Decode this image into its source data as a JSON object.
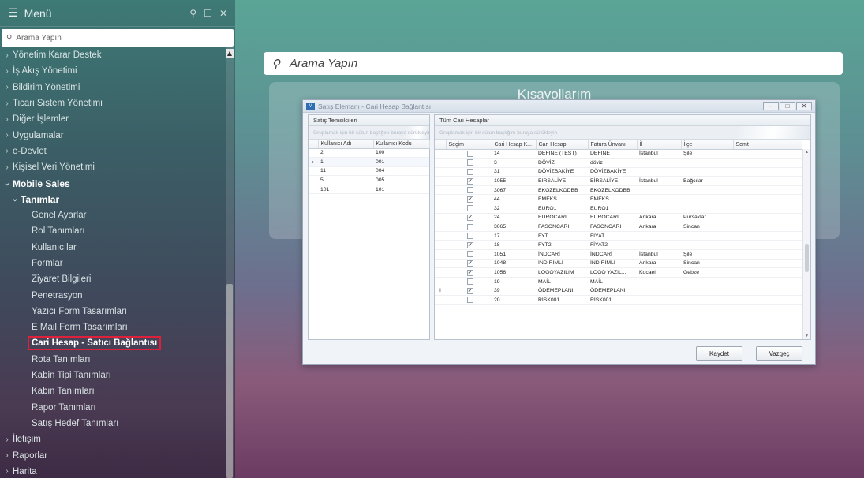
{
  "sidebar": {
    "title": "Menü",
    "search_placeholder": "Arama Yapın",
    "items": [
      {
        "label": "Yönetim Karar Destek",
        "level": 0,
        "chevron": "›"
      },
      {
        "label": "İş Akış Yönetimi",
        "level": 0,
        "chevron": "›"
      },
      {
        "label": "Bildirim Yönetimi",
        "level": 0,
        "chevron": "›"
      },
      {
        "label": "Ticari Sistem Yönetimi",
        "level": 0,
        "chevron": "›"
      },
      {
        "label": "Diğer İşlemler",
        "level": 0,
        "chevron": "›"
      },
      {
        "label": "Uygulamalar",
        "level": 0,
        "chevron": "›"
      },
      {
        "label": "e-Devlet",
        "level": 0,
        "chevron": "›"
      },
      {
        "label": "Kişisel Veri Yönetimi",
        "level": 0,
        "chevron": "›"
      },
      {
        "label": "Mobile Sales",
        "level": 0,
        "chevron": "⌄",
        "bold": true
      },
      {
        "label": "Tanımlar",
        "level": 1,
        "chevron": "⌄",
        "bold": true
      },
      {
        "label": "Genel Ayarlar",
        "level": 2
      },
      {
        "label": "Rol Tanımları",
        "level": 2
      },
      {
        "label": "Kullanıcılar",
        "level": 2
      },
      {
        "label": "Formlar",
        "level": 2
      },
      {
        "label": "Ziyaret Bilgileri",
        "level": 2
      },
      {
        "label": "Penetrasyon",
        "level": 2
      },
      {
        "label": "Yazıcı Form Tasarımları",
        "level": 2
      },
      {
        "label": "E Mail Form Tasarımları",
        "level": 2
      },
      {
        "label": "Cari Hesap - Satıcı Bağlantısı",
        "level": 2,
        "selected": true
      },
      {
        "label": "Rota Tanımları",
        "level": 2
      },
      {
        "label": "Kabin Tipi Tanımları",
        "level": 2
      },
      {
        "label": "Kabin Tanımları",
        "level": 2
      },
      {
        "label": "Rapor Tanımları",
        "level": 2
      },
      {
        "label": "Satış Hedef Tanımları",
        "level": 2
      },
      {
        "label": "İletişim",
        "level": 0,
        "chevron": "›"
      },
      {
        "label": "Raporlar",
        "level": 0,
        "chevron": "›"
      },
      {
        "label": "Harita",
        "level": 0,
        "chevron": "›"
      }
    ]
  },
  "main": {
    "search_placeholder": "Arama Yapın",
    "shortcuts_title": "Kısayollarım"
  },
  "dialog": {
    "title": "Satış Elemanı - Cari Hesap Bağlantısı",
    "app_icon_text": "M",
    "left_panel": {
      "caption": "Satış Temsilcileri",
      "group_hint": "Gruplamak için bir sütun başlığını buraya sürükleyin",
      "columns": [
        "Kullanıcı Adı",
        "Kullanıcı Kodu"
      ],
      "rows": [
        {
          "ind": "",
          "cells": [
            "2",
            "100"
          ]
        },
        {
          "ind": "▸",
          "cells": [
            "1",
            "001"
          ]
        },
        {
          "ind": "",
          "cells": [
            "11",
            "004"
          ]
        },
        {
          "ind": "",
          "cells": [
            "5",
            "005"
          ]
        },
        {
          "ind": "",
          "cells": [
            "101",
            "101"
          ]
        }
      ]
    },
    "right_panel": {
      "caption": "Tüm Cari Hesaplar",
      "group_hint": "Gruplamak için bir sütun başlığını buraya sürükleyin",
      "columns": [
        "Seçim",
        "Cari Hesap K...",
        "Cari Hesap",
        "Fatura Ünvanı",
        "İl",
        "İlçe",
        "Semt"
      ],
      "rows": [
        {
          "ind": "",
          "checked": false,
          "cells": [
            "14",
            "DEFINE (TEST)",
            "DEFINE",
            "İstanbul",
            "Şile",
            ""
          ]
        },
        {
          "ind": "",
          "checked": false,
          "cells": [
            "3",
            "DÖVİZ",
            "döviz",
            "",
            "",
            ""
          ]
        },
        {
          "ind": "",
          "checked": false,
          "cells": [
            "31",
            "DÖVİZBAKİYE",
            "DÖVİZBAKİYE",
            "",
            "",
            ""
          ]
        },
        {
          "ind": "",
          "checked": true,
          "cells": [
            "1055",
            "EIRSALİYE",
            "EİRSALİYE",
            "İstanbul",
            "Bağcılar",
            ""
          ]
        },
        {
          "ind": "",
          "checked": false,
          "cells": [
            "3067",
            "EKOZELKODBB",
            "EKOZELKODBB",
            "",
            "",
            ""
          ]
        },
        {
          "ind": "",
          "checked": true,
          "cells": [
            "44",
            "EMEKS",
            "EMEKS",
            "",
            "",
            ""
          ]
        },
        {
          "ind": "",
          "checked": false,
          "cells": [
            "32",
            "EURO1",
            "EURO1",
            "",
            "",
            ""
          ]
        },
        {
          "ind": "",
          "checked": true,
          "cells": [
            "24",
            "EUROCARI",
            "EUROCARI",
            "Ankara",
            "Pursaklar",
            ""
          ]
        },
        {
          "ind": "",
          "checked": false,
          "cells": [
            "3065",
            "FASONCARI",
            "FASONCARI",
            "Ankara",
            "Sincan",
            ""
          ]
        },
        {
          "ind": "",
          "checked": false,
          "cells": [
            "17",
            "FYT",
            "FİYAT",
            "",
            "",
            ""
          ]
        },
        {
          "ind": "",
          "checked": true,
          "cells": [
            "18",
            "FYT2",
            "FİYAT2",
            "",
            "",
            ""
          ]
        },
        {
          "ind": "",
          "checked": false,
          "cells": [
            "1051",
            "İNDCARİ",
            "İNDCARİ",
            "İstanbul",
            "Şile",
            ""
          ]
        },
        {
          "ind": "",
          "checked": true,
          "cells": [
            "1048",
            "İNDİRİMLİ",
            "İNDİRİMLİ",
            "Ankara",
            "Sincan",
            ""
          ]
        },
        {
          "ind": "",
          "checked": true,
          "cells": [
            "1056",
            "LOGOYAZILIM",
            "LOGO YAZIL...",
            "Kocaeli",
            "Gebze",
            ""
          ]
        },
        {
          "ind": "",
          "checked": false,
          "cells": [
            "19",
            "MAİL",
            "MAİL",
            "",
            "",
            ""
          ]
        },
        {
          "ind": "I",
          "checked": true,
          "cells": [
            "39",
            "ÖDEMEPLANI",
            "ÖDEMEPLANI",
            "",
            "",
            ""
          ]
        },
        {
          "ind": "",
          "checked": false,
          "cells": [
            "20",
            "RİSK001",
            "RİSK001",
            "",
            "",
            ""
          ]
        }
      ]
    },
    "buttons": {
      "save": "Kaydet",
      "cancel": "Vazgeç"
    }
  }
}
